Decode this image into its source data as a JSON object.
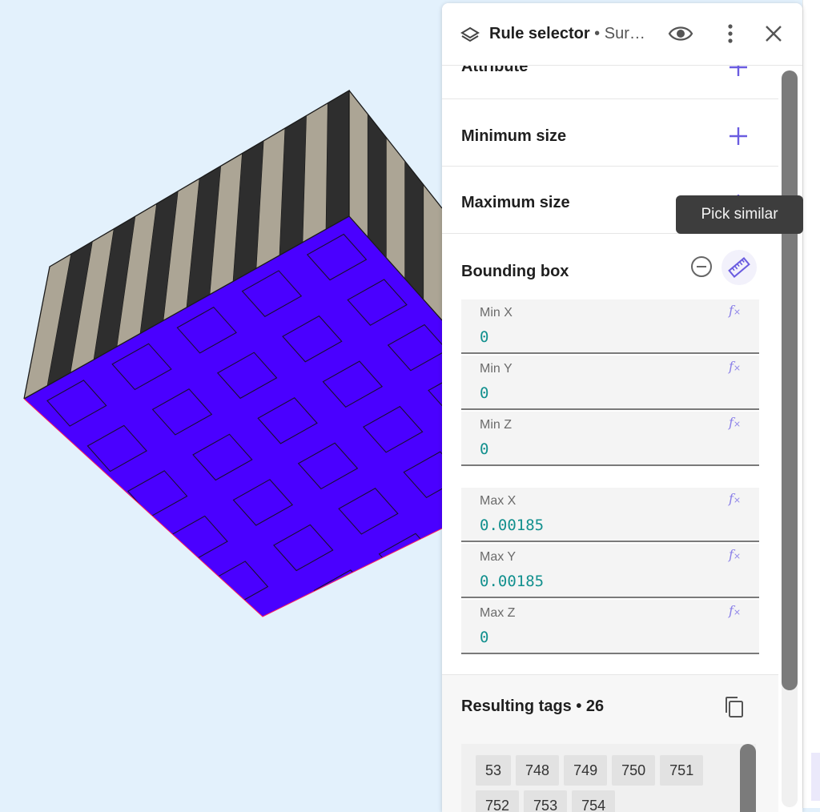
{
  "colors": {
    "viewport_bg": "#e3f1fc",
    "mesh_face_top": "#4a00ff",
    "mesh_stripe_light": "#aca595",
    "mesh_stripe_dark": "#2e2e2e",
    "accent": "#6a5ce0",
    "value_text": "#12908e",
    "tooltip_bg": "#3d3d3d"
  },
  "panel": {
    "title": "Rule selector",
    "subtitle": " • Sur…",
    "icons": {
      "title_icon": "rule-selector-icon",
      "visibility": "eye-icon",
      "menu": "more-vertical-icon",
      "close": "close-icon"
    },
    "sections": {
      "attribute": {
        "label": "Attribute",
        "action_icon": "plus-icon"
      },
      "minimum_size": {
        "label": "Minimum size",
        "action_icon": "plus-icon"
      },
      "maximum_size": {
        "label": "Maximum size",
        "action_icon": "plus-icon"
      },
      "bounding_box": {
        "label": "Bounding box",
        "remove_icon": "minus-circle-icon",
        "pick_icon": "ruler-icon",
        "fields": [
          {
            "label": "Min X",
            "value": "0"
          },
          {
            "label": "Min Y",
            "value": "0"
          },
          {
            "label": "Min Z",
            "value": "0"
          },
          {
            "label": "Max X",
            "value": "0.00185"
          },
          {
            "label": "Max Y",
            "value": "0.00185"
          },
          {
            "label": "Max Z",
            "value": "0"
          }
        ],
        "fx_icon": "function-icon"
      }
    },
    "resulting_tags": {
      "label": "Resulting tags",
      "count": "26",
      "copy_icon": "copy-icon",
      "tags": [
        "53",
        "748",
        "749",
        "750",
        "751",
        "752",
        "753",
        "754"
      ]
    }
  },
  "tooltip": {
    "text": "Pick similar"
  }
}
